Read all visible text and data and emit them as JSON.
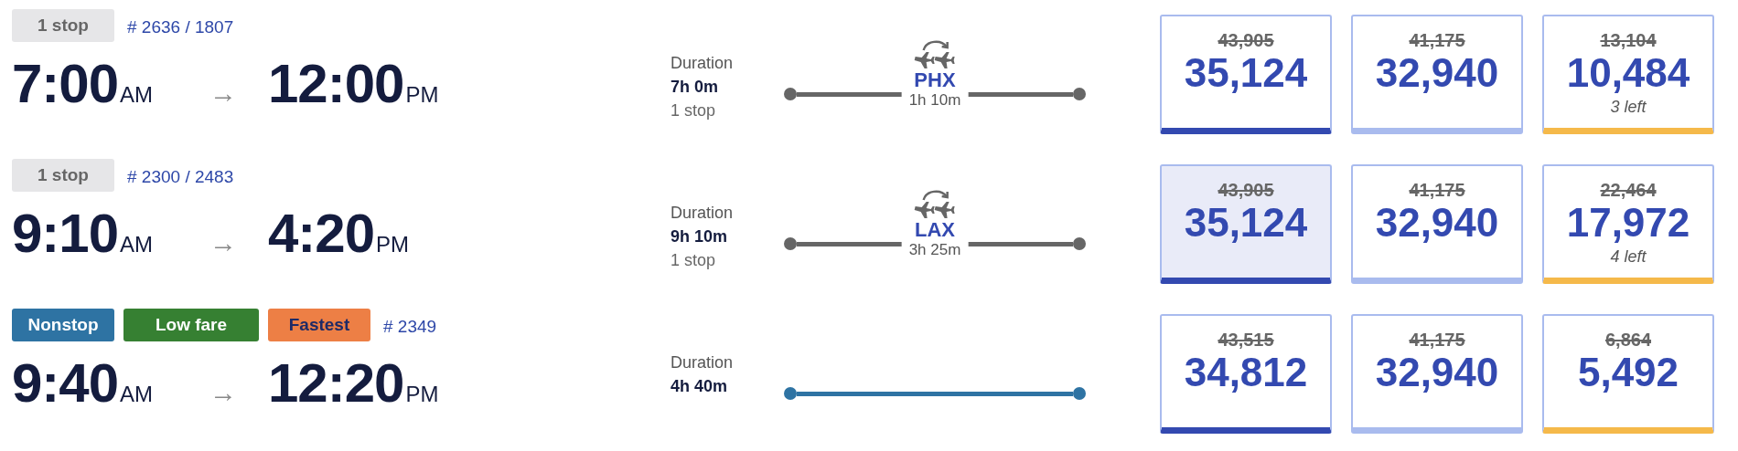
{
  "flights": [
    {
      "badges": [
        {
          "label": "1 stop",
          "kind": "neutral"
        }
      ],
      "flight_number": "# 2636 / 1807",
      "depart": {
        "time": "7:00",
        "period": "AM"
      },
      "arrow": "→",
      "arrive": {
        "time": "12:00",
        "period": "PM"
      },
      "duration_label": "Duration",
      "duration": "7h 0m",
      "stops": "1 stop",
      "route": {
        "color": "#666666",
        "stop": {
          "code": "PHX",
          "layover": "1h 10m"
        }
      },
      "fares": [
        {
          "was": "43,905",
          "price": "35,124",
          "selected": false,
          "color": "#3349b0"
        },
        {
          "was": "41,175",
          "price": "32,940",
          "selected": false,
          "color": "#a9bbee"
        },
        {
          "was": "13,104",
          "price": "10,484",
          "left": "3 left",
          "selected": false,
          "color": "#f5b94a"
        }
      ]
    },
    {
      "badges": [
        {
          "label": "1 stop",
          "kind": "neutral"
        }
      ],
      "flight_number": "# 2300 / 2483",
      "depart": {
        "time": "9:10",
        "period": "AM"
      },
      "arrow": "→",
      "arrive": {
        "time": "4:20",
        "period": "PM"
      },
      "duration_label": "Duration",
      "duration": "9h 10m",
      "stops": "1 stop",
      "route": {
        "color": "#666666",
        "stop": {
          "code": "LAX",
          "layover": "3h 25m"
        }
      },
      "fares": [
        {
          "was": "43,905",
          "price": "35,124",
          "selected": true,
          "color": "#3349b0"
        },
        {
          "was": "41,175",
          "price": "32,940",
          "selected": false,
          "color": "#a9bbee"
        },
        {
          "was": "22,464",
          "price": "17,972",
          "left": "4 left",
          "selected": false,
          "color": "#f5b94a"
        }
      ]
    },
    {
      "badges": [
        {
          "label": "Nonstop",
          "kind": "info"
        },
        {
          "label": "Low fare",
          "kind": "success"
        },
        {
          "label": "Fastest",
          "kind": "warning"
        }
      ],
      "flight_number": "# 2349",
      "depart": {
        "time": "9:40",
        "period": "AM"
      },
      "arrow": "→",
      "arrive": {
        "time": "12:20",
        "period": "PM"
      },
      "duration_label": "Duration",
      "duration": "4h 40m",
      "route": {
        "color": "#2e73a3"
      },
      "fares": [
        {
          "was": "43,515",
          "price": "34,812",
          "selected": false,
          "color": "#3349b0"
        },
        {
          "was": "41,175",
          "price": "32,940",
          "selected": false,
          "color": "#a9bbee"
        },
        {
          "was": "6,864",
          "price": "5,492",
          "selected": false,
          "color": "#f5b94a"
        }
      ]
    }
  ]
}
